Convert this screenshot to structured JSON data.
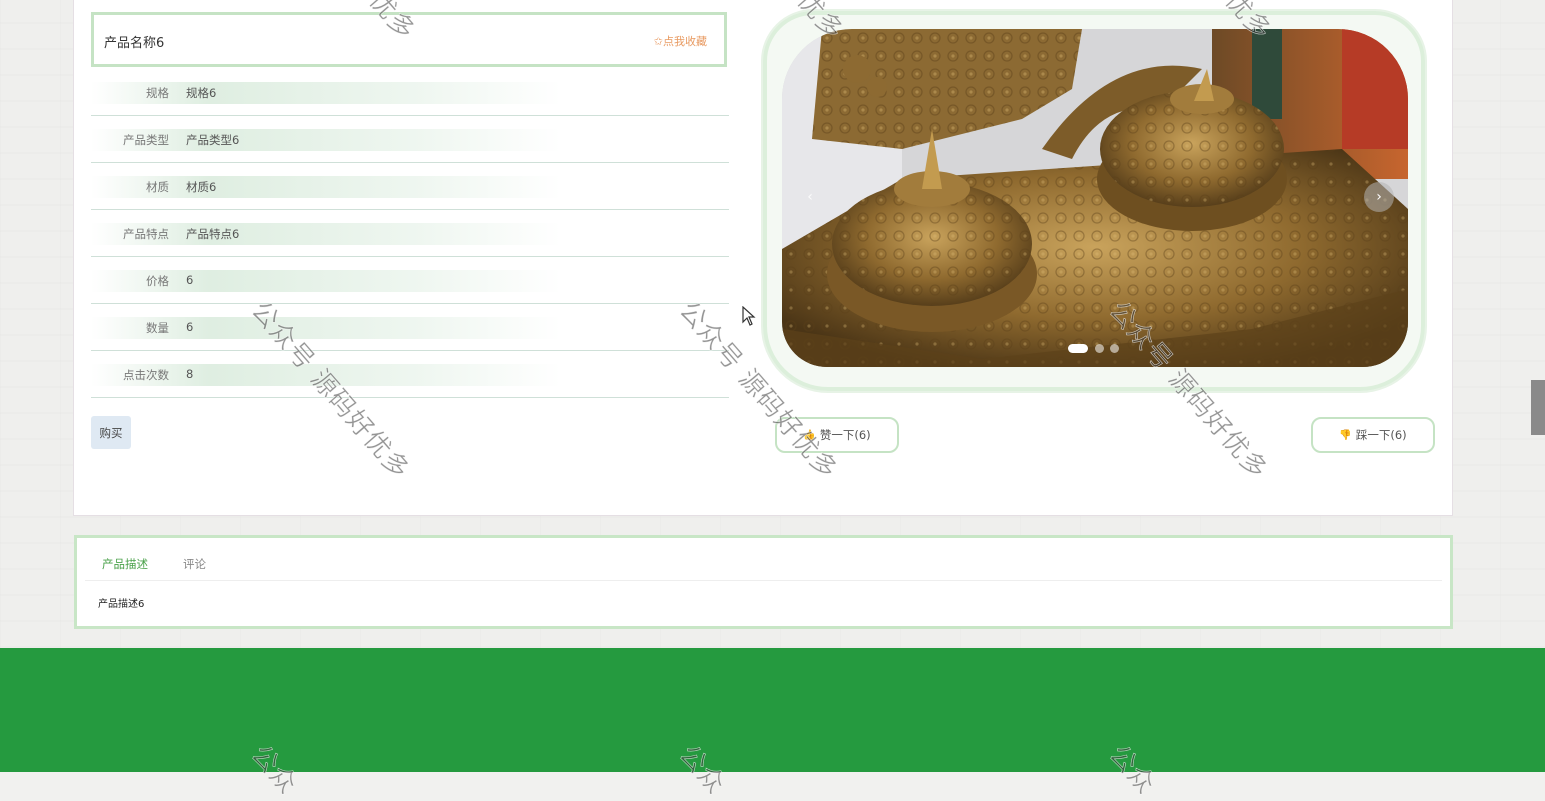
{
  "product": {
    "name": "产品名称6",
    "collect_label": "✩点我收藏",
    "attributes": [
      {
        "label": "规格",
        "value": "规格6"
      },
      {
        "label": "产品类型",
        "value": "产品类型6"
      },
      {
        "label": "材质",
        "value": "材质6"
      },
      {
        "label": "产品特点",
        "value": "产品特点6"
      },
      {
        "label": "价格",
        "value": "6"
      },
      {
        "label": "数量",
        "value": "6"
      },
      {
        "label": "点击次数",
        "value": "8"
      }
    ],
    "buy_label": "购买"
  },
  "carousel": {
    "prev_icon": "‹",
    "next_icon": "›",
    "slide_count": 3,
    "active_slide": 1
  },
  "votes": {
    "like_label": "赞一下(6)",
    "like_icon": "thumbs-up-icon",
    "dislike_label": "踩一下(6)",
    "dislike_icon": "thumbs-down-icon"
  },
  "tabs": {
    "items": [
      {
        "label": "产品描述"
      },
      {
        "label": "评论"
      }
    ],
    "active_content": "产品描述6"
  },
  "watermark": {
    "text": "公众号 源码好优多",
    "partial_text": "优多",
    "bottom_text": "公众"
  },
  "colors": {
    "accent_green": "#4aa14a",
    "frame_green": "#c5e3c4",
    "footer_green": "#259a3f",
    "collect_orange": "#e89a61"
  }
}
